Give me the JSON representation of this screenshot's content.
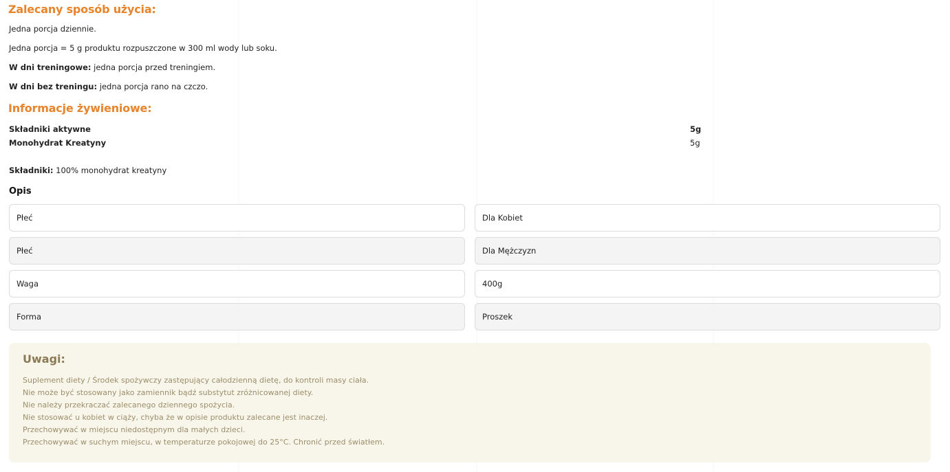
{
  "usage": {
    "title": "Zalecany sposób użycia:",
    "lines": [
      {
        "bold": "",
        "text": "Jedna porcja dziennie."
      },
      {
        "bold": "",
        "text": "Jedna porcja = 5 g produktu rozpuszczone w 300 ml wody lub soku."
      },
      {
        "bold": "W dni treningowe:",
        "text": " jedna porcja przed treningiem."
      },
      {
        "bold": "W dni bez treningu:",
        "text": " jedna porcja rano na czczo."
      }
    ]
  },
  "nutrition": {
    "title": "Informacje żywieniowe:",
    "rows": [
      {
        "name": "Składniki aktywne",
        "value": "5g"
      },
      {
        "name": "Monohydrat Kreatyny",
        "value": "5g"
      }
    ],
    "ingredients_label": "Składniki:",
    "ingredients_text": " 100% monohydrat kreatyny"
  },
  "description": {
    "title": "Opis",
    "attributes": [
      {
        "key": "Płeć",
        "value": "Dla Kobiet"
      },
      {
        "key": "Płeć",
        "value": "Dla Mężczyzn"
      },
      {
        "key": "Waga",
        "value": "400g"
      },
      {
        "key": "Forma",
        "value": "Proszek"
      }
    ]
  },
  "notes": {
    "title": "Uwagi:",
    "items": [
      "Suplement diety / Środek spożywczy zastępujący całodzienną dietę, do kontroli masy ciała.",
      "Nie może być stosowany jako zamiennik bądź substytut zróżnicowanej diety.",
      "Nie należy przekraczać zalecanego dziennego spożycia.",
      "Nie stosować u kobiet w ciąży, chyba że w opisie produktu zalecane jest inaczej.",
      "Przechowywać w miejscu niedostępnym dla małych dzieci.",
      "Przechowywać w suchym miejscu, w temperaturze pokojowej do 25°C. Chronić przed światłem."
    ]
  },
  "colors": {
    "heading_orange": "#e8842b",
    "notes_bg": "#f8f6ea",
    "notes_title": "#8a7a56",
    "notes_text": "#9b8d6a",
    "cell_border": "#dcdcdc",
    "cell_alt_bg": "#f4f4f4"
  }
}
